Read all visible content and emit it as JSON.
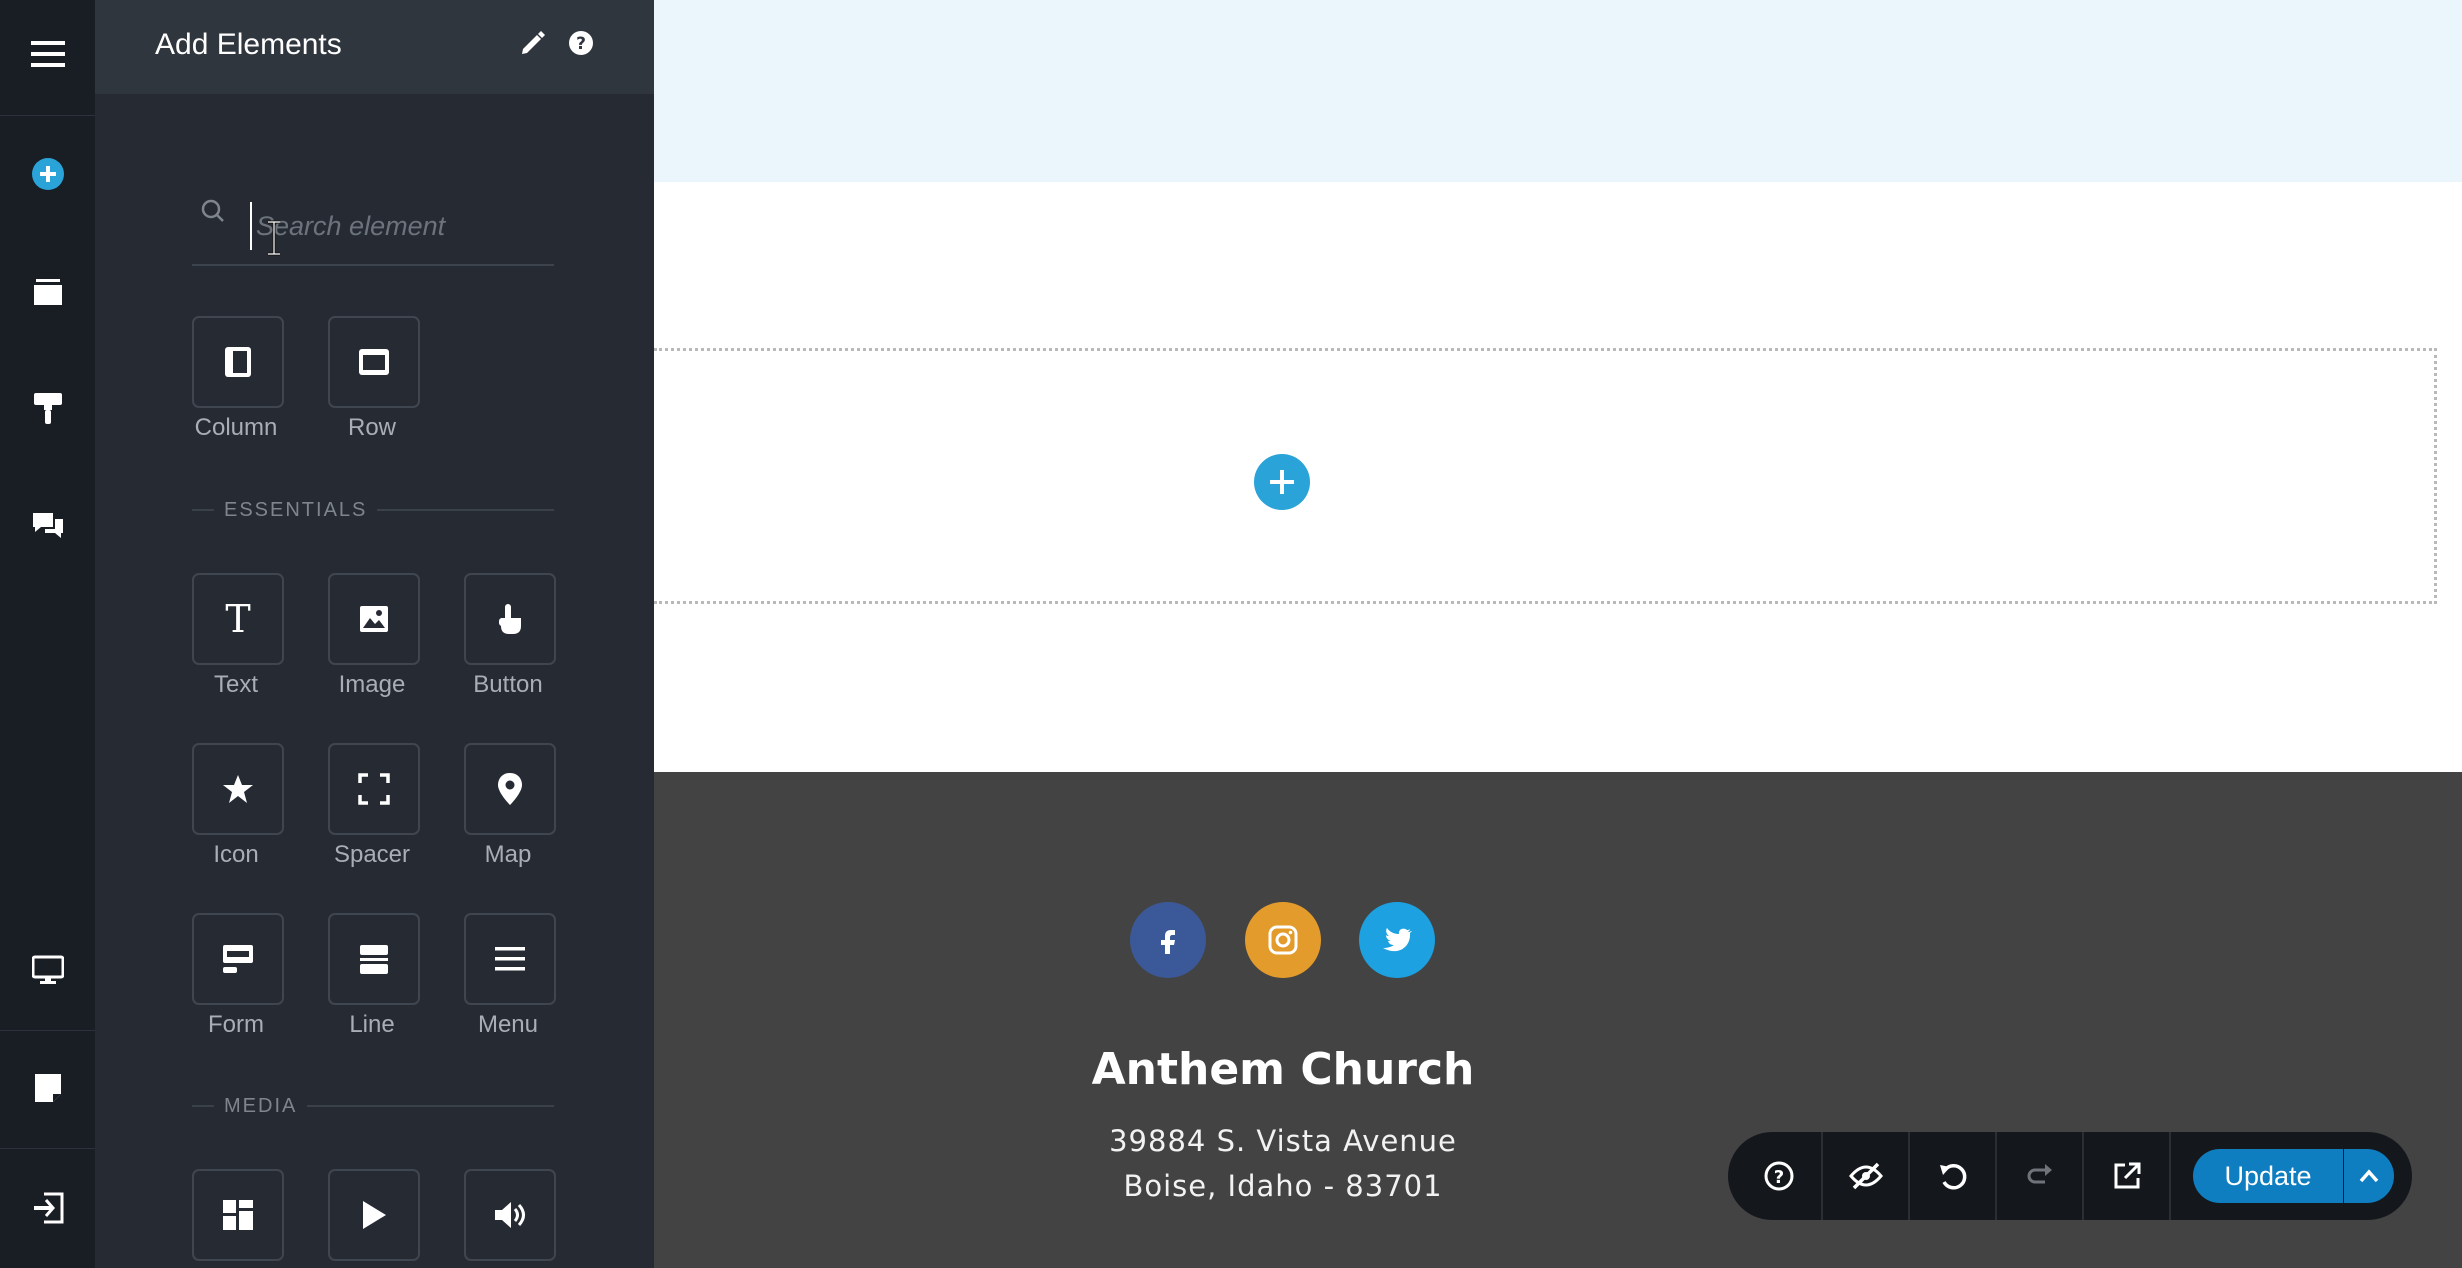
{
  "panel": {
    "title": "Add Elements",
    "search_placeholder": "Search element",
    "layout_items": [
      {
        "label": "Column",
        "icon": "column-icon"
      },
      {
        "label": "Row",
        "icon": "row-icon"
      }
    ],
    "essentials_heading": "ESSENTIALS",
    "essentials": [
      {
        "label": "Text",
        "icon": "text-icon"
      },
      {
        "label": "Image",
        "icon": "image-icon"
      },
      {
        "label": "Button",
        "icon": "button-icon"
      },
      {
        "label": "Icon",
        "icon": "star-icon"
      },
      {
        "label": "Spacer",
        "icon": "spacer-icon"
      },
      {
        "label": "Map",
        "icon": "map-pin-icon"
      },
      {
        "label": "Form",
        "icon": "form-icon"
      },
      {
        "label": "Line",
        "icon": "line-icon"
      },
      {
        "label": "Menu",
        "icon": "menu-icon"
      }
    ],
    "media_heading": "MEDIA",
    "media": [
      {
        "icon": "gallery-icon"
      },
      {
        "icon": "video-icon"
      },
      {
        "icon": "audio-icon"
      }
    ]
  },
  "footer": {
    "church_name": "Anthem Church",
    "address_line1": "39884 S. Vista Avenue",
    "address_line2": "Boise, Idaho - 83701",
    "social": [
      {
        "name": "facebook",
        "color": "#3b5998"
      },
      {
        "name": "instagram",
        "color": "#e39b2b"
      },
      {
        "name": "twitter",
        "color": "#1da1e0"
      }
    ]
  },
  "actionbar": {
    "update_label": "Update"
  },
  "colors": {
    "accent": "#2aa3d8",
    "update": "#0f7ec1",
    "sidebar": "#191e25",
    "panel": "#262b33",
    "footer": "#434343"
  }
}
